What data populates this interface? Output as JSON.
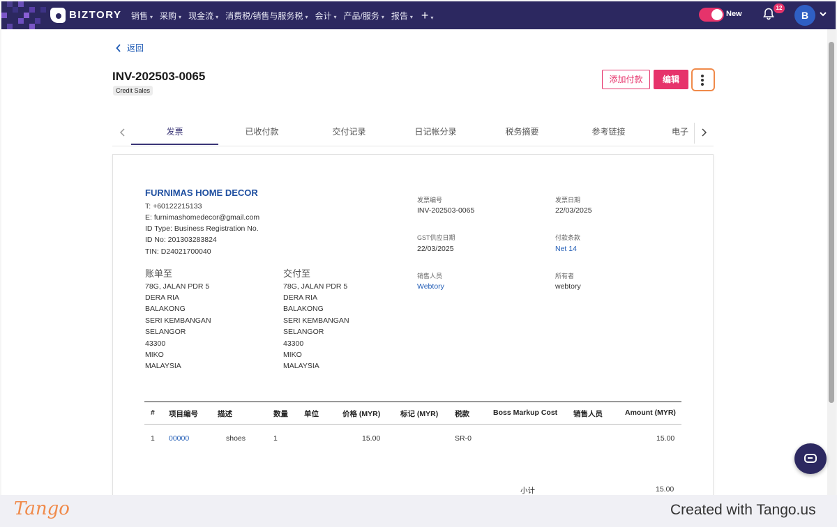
{
  "nav": {
    "brand": "BIZTORY",
    "menu": [
      {
        "label": "销售"
      },
      {
        "label": "采购"
      },
      {
        "label": "现金流"
      },
      {
        "label": "消费税/销售与服务税"
      },
      {
        "label": "会计"
      },
      {
        "label": "产品/服务"
      },
      {
        "label": "报告"
      }
    ],
    "plus_icon": "+",
    "toggle_label": "New",
    "notification_count": "12",
    "avatar_initial": "B"
  },
  "header": {
    "back_label": "返回",
    "invoice_number": "INV-202503-0065",
    "tag": "Credit Sales",
    "add_payment_label": "添加付款",
    "edit_label": "编辑"
  },
  "tabs": [
    {
      "label": "发票",
      "active": true
    },
    {
      "label": "已收付款"
    },
    {
      "label": "交付记录"
    },
    {
      "label": "日记帐分录"
    },
    {
      "label": "税务摘要"
    },
    {
      "label": "参考链接"
    },
    {
      "label": "电子"
    }
  ],
  "invoice": {
    "company": "FURNIMAS HOME DECOR",
    "company_lines": [
      "T: +60122215133",
      "E: furnimashomedecor@gmail.com",
      "ID Type: Business Registration No.",
      "ID No: 201303283824",
      "TIN: D24021700040"
    ],
    "bill_to": {
      "title": "账单至",
      "lines": [
        "78G, JALAN PDR 5",
        "DERA RIA",
        "BALAKONG",
        "SERI KEMBANGAN",
        "SELANGOR",
        "43300",
        "MIKO",
        "MALAYSIA"
      ]
    },
    "ship_to": {
      "title": "交付至",
      "lines": [
        "78G, JALAN PDR 5",
        "DERA RIA",
        "BALAKONG",
        "SERI KEMBANGAN",
        "SELANGOR",
        "43300",
        "MIKO",
        "MALAYSIA"
      ]
    },
    "meta": [
      {
        "label": "发票编号",
        "value": "INV-202503-0065"
      },
      {
        "label": "发票日期",
        "value": "22/03/2025"
      },
      {
        "label": "GST供应日期",
        "value": "22/03/2025"
      },
      {
        "label": "付款条款",
        "value": "Net 14",
        "link": true
      },
      {
        "label": "销售人员",
        "value": "Webtory",
        "link": true
      },
      {
        "label": "所有者",
        "value": "webtory"
      }
    ],
    "table": {
      "columns": [
        "#",
        "项目编号",
        "描述",
        "数量",
        "单位",
        "价格 (MYR)",
        "标记 (MYR)",
        "税款",
        "Boss Markup Cost",
        "销售人员",
        "Amount (MYR)"
      ],
      "rows": [
        {
          "num": "1",
          "item_code": "00000",
          "description": "shoes",
          "qty": "1",
          "unit": "",
          "price": "15.00",
          "markup": "",
          "tax": "SR-0",
          "boss_markup": "",
          "salesperson": "",
          "amount": "15.00"
        }
      ]
    },
    "subtotal_label": "小计",
    "subtotal_value": "15.00"
  },
  "footer": {
    "brand": "Tango",
    "credit": "Created with Tango.us"
  },
  "colors": {
    "nav_bg": "#2c2860",
    "accent": "#e6336b",
    "link": "#1f5bb5",
    "highlight": "#f08a4a"
  }
}
